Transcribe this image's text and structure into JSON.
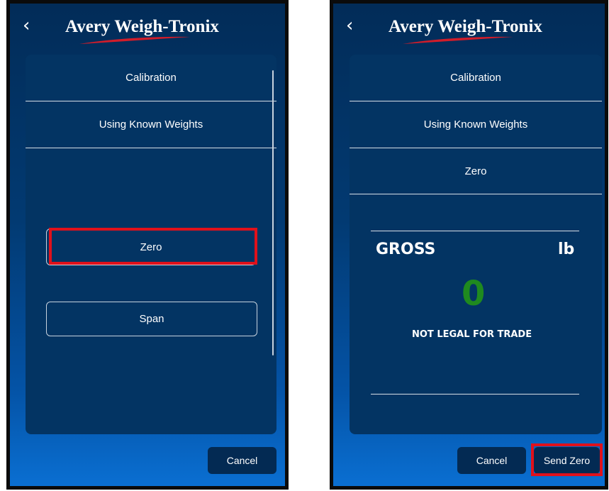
{
  "brand": "Avery Weigh-Tronix",
  "colors": {
    "highlight": "#e0111b",
    "weight_value": "#1f8a1f",
    "swoosh": "#d11d2a"
  },
  "icons": {
    "back": "chevron-left"
  },
  "left_screen": {
    "menu": [
      "Calibration",
      "Using Known Weights"
    ],
    "zero_button": "Zero",
    "span_button": "Span",
    "cancel_button": "Cancel"
  },
  "right_screen": {
    "menu": [
      "Calibration",
      "Using Known Weights",
      "Zero"
    ],
    "weight_mode": "GROSS",
    "unit": "lb",
    "weight_value": "0",
    "legal_notice": "NOT LEGAL FOR TRADE",
    "cancel_button": "Cancel",
    "send_zero_button": "Send Zero"
  }
}
